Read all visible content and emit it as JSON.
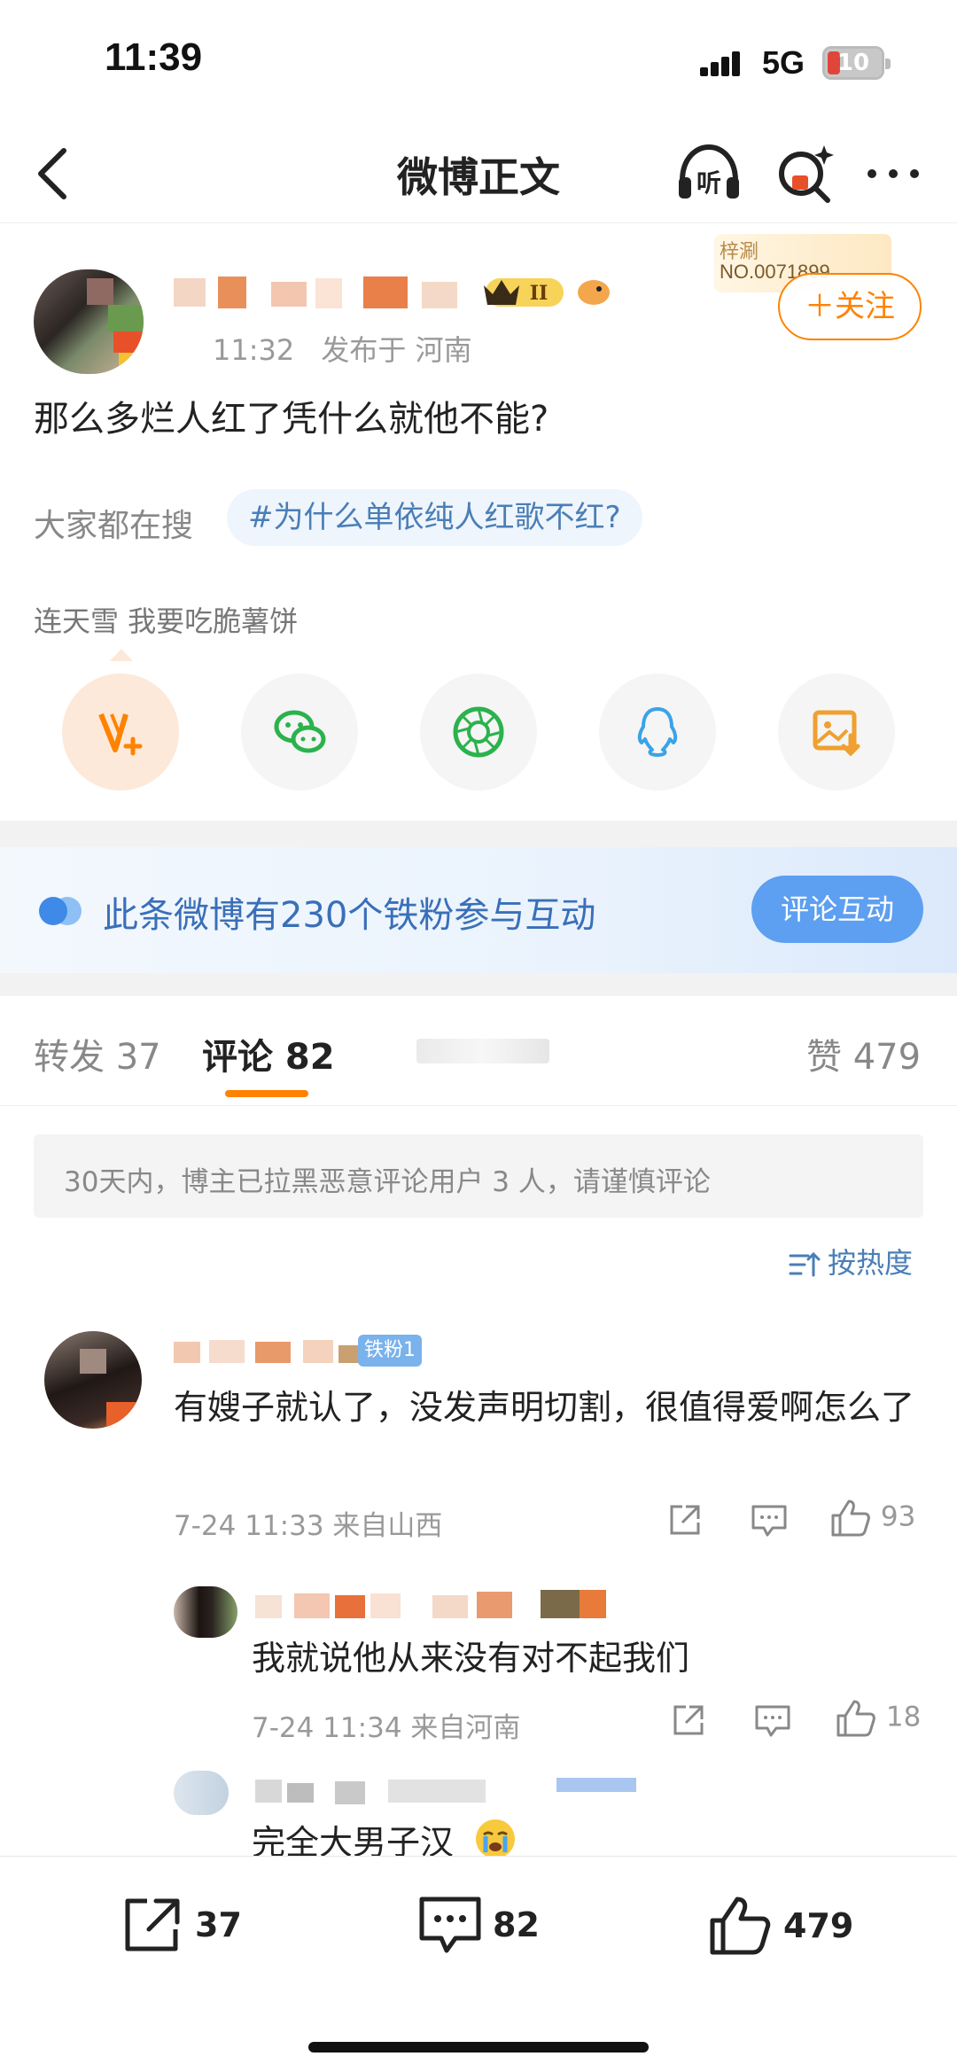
{
  "status_bar": {
    "time": "11:39",
    "network": "5G",
    "battery": "10"
  },
  "header": {
    "title": "微博正文"
  },
  "post": {
    "time_partial": "11:32",
    "publish_label": "发布于 河南",
    "fans_card_name": "梓涮",
    "fans_card_no": "NO.0071899",
    "follow_label": "＋关注",
    "text": "那么多烂人红了凭什么就他不能?",
    "hot_search_label": "大家都在搜",
    "topic": "#为什么单依纯人红歌不红?",
    "share_hint": "连天雪 我要吃脆薯饼",
    "share_targets": [
      "weibo-icon",
      "wechat-icon",
      "moments-icon",
      "qq-icon",
      "save-image-icon"
    ]
  },
  "banner": {
    "text": "此条微博有230个铁粉参与互动",
    "button": "评论互动"
  },
  "tabs": {
    "repost": "转发 37",
    "comments": "评论 82",
    "likes": "赞 479"
  },
  "notice": "30天内，博主已拉黑恶意评论用户 3 人，请谨慎评论",
  "sort_label": "按热度",
  "comments": [
    {
      "badge": "铁粉1",
      "text": "有嫂子就认了，没发声明切割，很值得爱啊怎么了",
      "meta": "7-24 11:33 来自山西",
      "likes": "93",
      "replies": [
        {
          "text": "我就说他从来没有对不起我们",
          "meta": "7-24 11:34 来自河南",
          "likes": "18"
        },
        {
          "text": "完全大男子汉"
        }
      ]
    }
  ],
  "bottom_bar": {
    "repost": "37",
    "comment": "82",
    "like": "479"
  },
  "colors": {
    "accent": "#ff8200",
    "link": "#4a7eb6",
    "banner_button": "#5d9ff0"
  }
}
